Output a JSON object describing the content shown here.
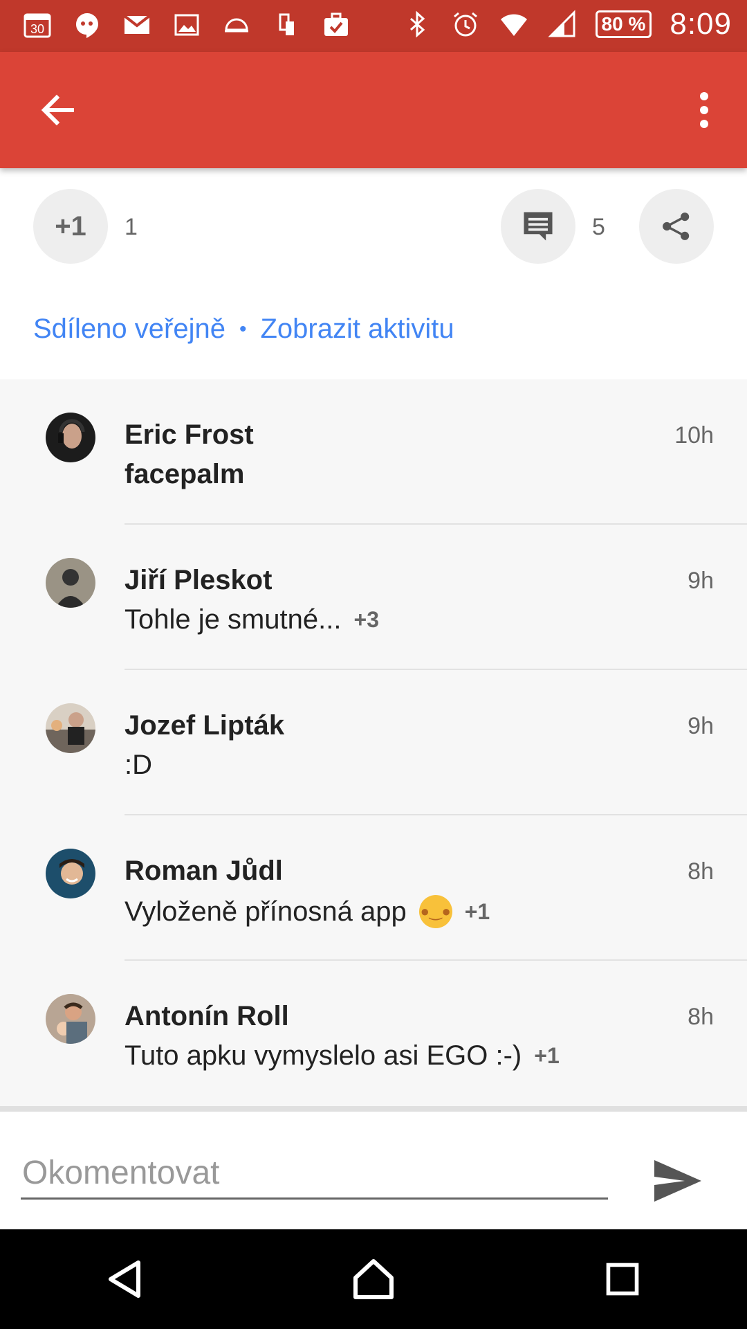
{
  "status_bar": {
    "calendar_day": "30",
    "battery": "80 %",
    "time": "8:09"
  },
  "actions": {
    "plus_one_label": "+1",
    "plus_one_count": "1",
    "comment_count": "5"
  },
  "links": {
    "shared_publicly": "Sdíleno veřejně",
    "separator": "•",
    "show_activity": "Zobrazit aktivitu"
  },
  "comments": [
    {
      "name": "Eric Frost",
      "time": "10h",
      "text": "facepalm",
      "plus": ""
    },
    {
      "name": "Jiří Pleskot",
      "time": "9h",
      "text": "Tohle je smutné...",
      "plus": "+3"
    },
    {
      "name": "Jozef Lipták",
      "time": "9h",
      "text": ":D",
      "plus": ""
    },
    {
      "name": "Roman Jůdl",
      "time": "8h",
      "text": "Vyloženě přínosná app",
      "plus": "+1"
    },
    {
      "name": "Antonín Roll",
      "time": "8h",
      "text": "Tuto apku vymyslelo asi EGO :-)",
      "plus": "+1"
    }
  ],
  "composer": {
    "placeholder": "Okomentovat"
  },
  "colors": {
    "status_bar": "#c0382b",
    "app_bar": "#db4437",
    "link": "#4285f4"
  }
}
